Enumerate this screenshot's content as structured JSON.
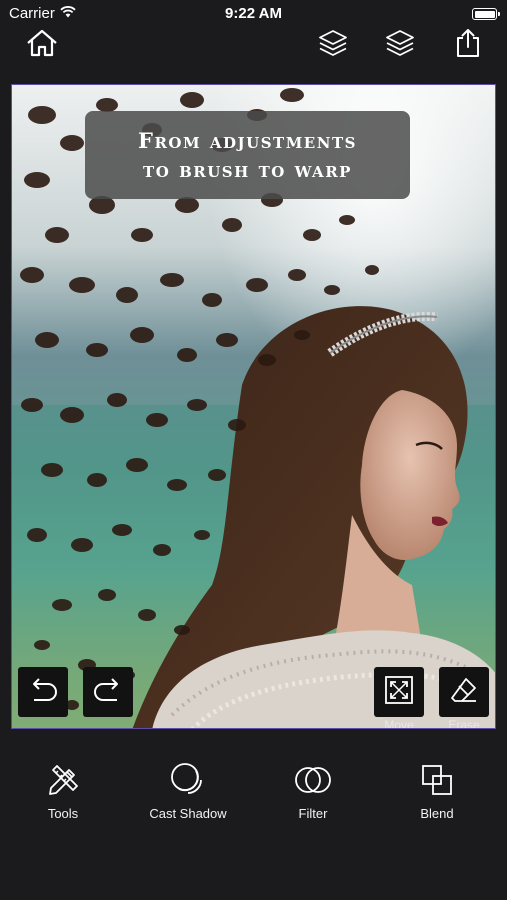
{
  "status_bar": {
    "carrier": "Carrier",
    "time": "9:22 AM"
  },
  "top_bar": {
    "icons": [
      "home-icon",
      "layers-icon",
      "layers-icon",
      "share-icon"
    ]
  },
  "canvas": {
    "caption": {
      "line1": "From adjustments",
      "line2": "to brush to warp"
    },
    "undo_icon": "undo-icon",
    "redo_icon": "redo-icon",
    "move_label": "Move",
    "erase_label": "Erase",
    "frame_color": "#5f4ea6"
  },
  "bottom_toolbar": {
    "items": [
      {
        "label": "Tools",
        "icon": "tools-icon"
      },
      {
        "label": "Cast Shadow",
        "icon": "cast-shadow-icon"
      },
      {
        "label": "Filter",
        "icon": "filter-icon"
      },
      {
        "label": "Blend",
        "icon": "blend-icon"
      }
    ]
  }
}
